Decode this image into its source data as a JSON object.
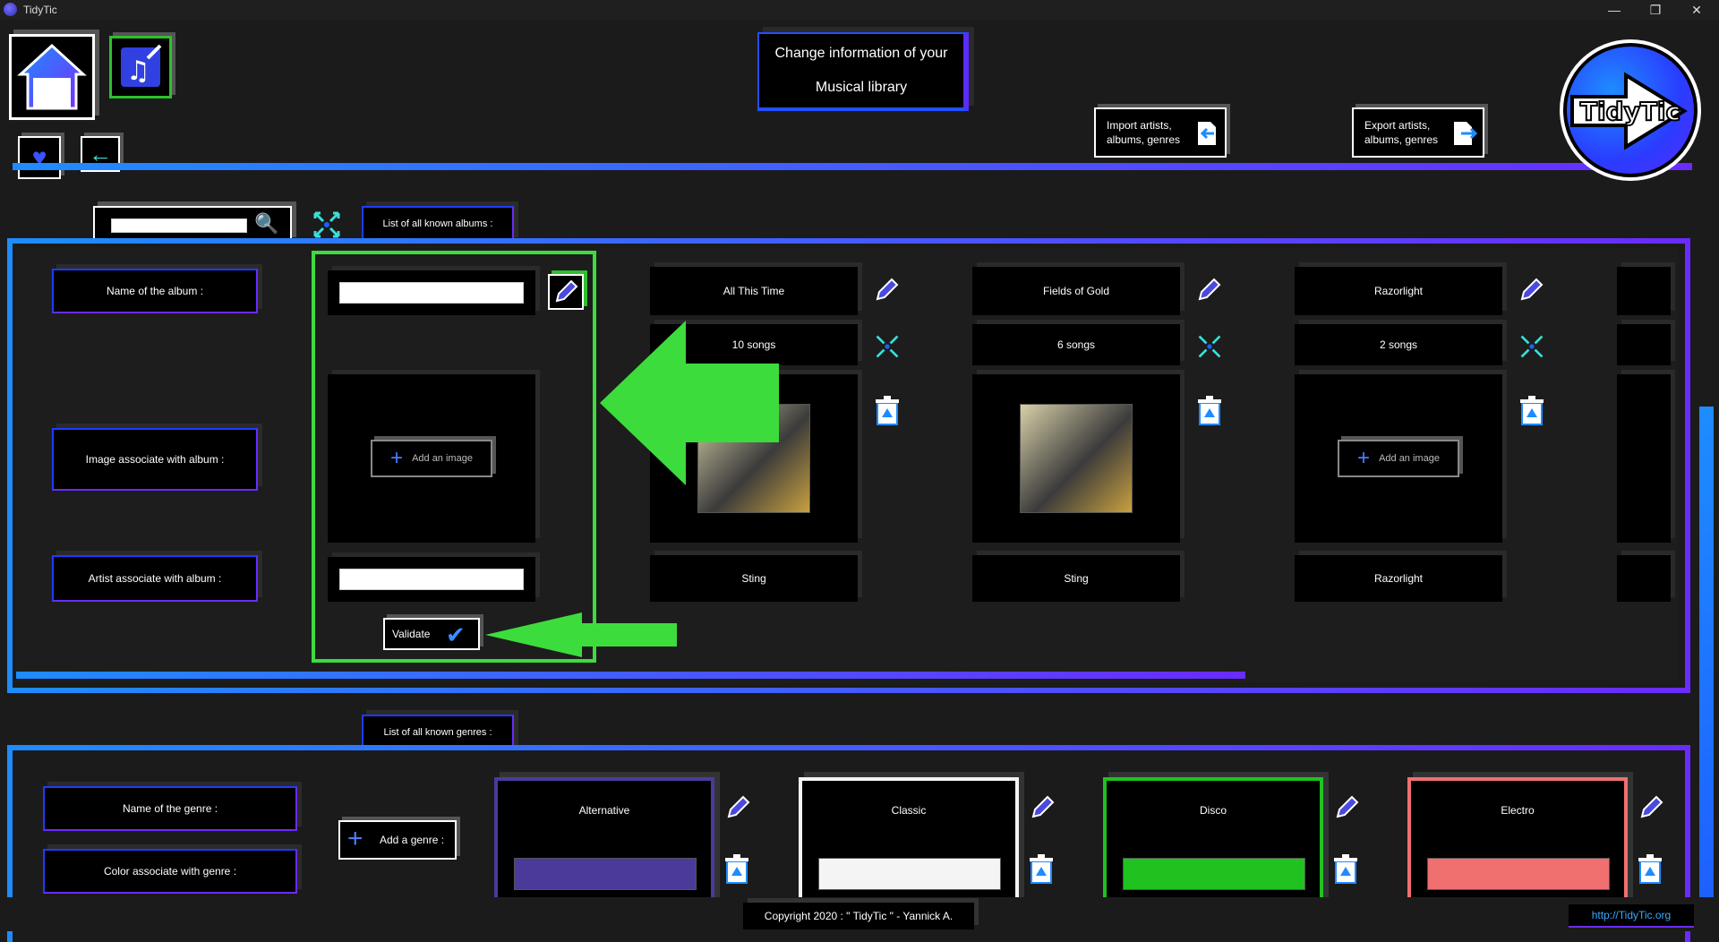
{
  "window": {
    "title": "TidyTic",
    "controls": [
      "minimize",
      "restore",
      "close"
    ]
  },
  "header": {
    "page_title_line1": "Change information of your",
    "page_title_line2": "Musical library",
    "import_label_line1": "Import artists,",
    "import_label_line2": "albums, genres",
    "export_label_line1": "Export artists,",
    "export_label_line2": "albums, genres",
    "logo_text": "TidyTic"
  },
  "albums_section": {
    "tab_label": "List of all known albums :",
    "search_value": "",
    "labels": {
      "name": "Name of the album :",
      "image": "Image associate with album :",
      "artist": "Artist associate with album :"
    },
    "new_album": {
      "name_value": "",
      "add_image_label": "Add an image",
      "artist_value": "",
      "validate_label": "Validate"
    },
    "albums": [
      {
        "name": "All This Time",
        "songs": "10 songs",
        "artist": "Sting",
        "has_image": true
      },
      {
        "name": "Fields of Gold",
        "songs": "6 songs",
        "artist": "Sting",
        "has_image": true
      },
      {
        "name": "Razorlight",
        "songs": "2 songs",
        "artist": "Razorlight",
        "has_image": false,
        "add_image_label": "Add an image"
      }
    ],
    "scroll_fraction": 0.74
  },
  "genres_section": {
    "tab_label": "List of all known genres :",
    "labels": {
      "name": "Name of the genre :",
      "color": "Color associate with genre :"
    },
    "add_genre_label": "Add a genre :",
    "genres": [
      {
        "name": "Alternative",
        "color": "#4b3a9a"
      },
      {
        "name": "Classic",
        "color": "#f4f4f4"
      },
      {
        "name": "Disco",
        "color": "#1fc21f"
      },
      {
        "name": "Electro",
        "color": "#f07070"
      }
    ]
  },
  "footer": {
    "copyright": "Copyright 2020 : \" TidyTic \" - Yannick A.",
    "website": "http://TidyTic.org"
  },
  "colors": {
    "accent_blue": "#1e8cff",
    "accent_purple": "#6a2bff",
    "highlight_green": "#3ddc3d"
  }
}
